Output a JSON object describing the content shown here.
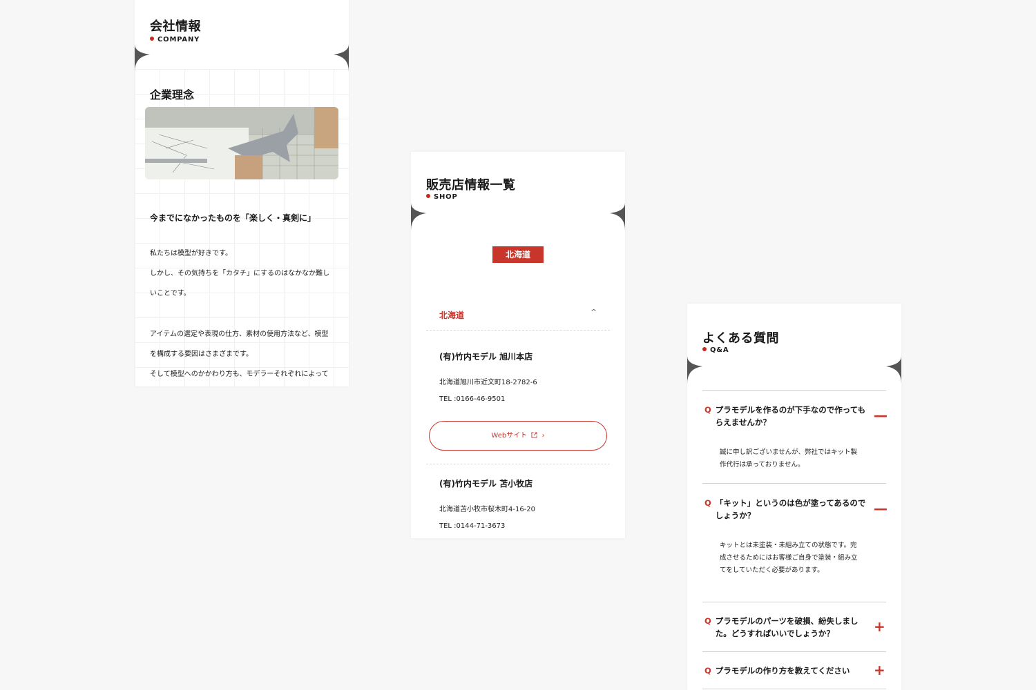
{
  "colors": {
    "accent": "#c8352a",
    "background": "#f7f7f7",
    "notch": "#555555"
  },
  "company": {
    "title": "会社情報",
    "subtitle": "COMPANY",
    "section_title": "企業理念",
    "photo_icon": "model-building-photo",
    "lead": "今までになかったものを「楽しく・真剣に」",
    "paragraphs": [
      "私たちは模型が好きです。",
      "しかし、その気持ちを「カタチ」にするのはなかなか難し",
      "いことです。",
      "アイテムの選定や表現の仕方、素材の使用方法など、模型",
      "を構成する要因はさまざまです。",
      "そして模型へのかかわり方も、モデラーそれぞれによって"
    ]
  },
  "shop": {
    "title": "販売店情報一覧",
    "subtitle": "SHOP",
    "prefecture_badge": "北海道",
    "accordion_label": "北海道",
    "accordion_icon": "chevron-up-icon",
    "stores": [
      {
        "name": "(有)竹内モデル 旭川本店",
        "address": "北海道旭川市近文町18-2782-6",
        "tel": "TEL :0166-46-9501",
        "web_label": "Webサイト"
      },
      {
        "name": "(有)竹内モデル 苫小牧店",
        "address": "北海道苫小牧市桜木町4-16-20",
        "tel": "TEL :0144-71-3673"
      }
    ]
  },
  "faq": {
    "title": "よくある質問",
    "subtitle": "Q&A",
    "q_marker": "Q",
    "items": [
      {
        "q": "プラモデルを作るのが下手なので作ってもらえませんか？",
        "a": "誠に申し訳ございませんが、弊社ではキット製作代行は承っておりません。",
        "expanded": true,
        "icon": "minus-icon",
        "icon_glyph": "—"
      },
      {
        "q": "「キット」というのは色が塗ってあるのでしょうか？",
        "a": "キットとは未塗装・未組み立ての状態です。完成させるためにはお客様ご自身で塗装・組み立てをしていただく必要があります。",
        "expanded": true,
        "icon": "minus-icon",
        "icon_glyph": "—"
      },
      {
        "q": "プラモデルのパーツを破損、紛失しました。どうすればいいでしょうか？",
        "expanded": false,
        "icon": "plus-icon",
        "icon_glyph": "+"
      },
      {
        "q": "プラモデルの作り方を教えてください",
        "expanded": false,
        "icon": "plus-icon",
        "icon_glyph": "+"
      }
    ]
  }
}
